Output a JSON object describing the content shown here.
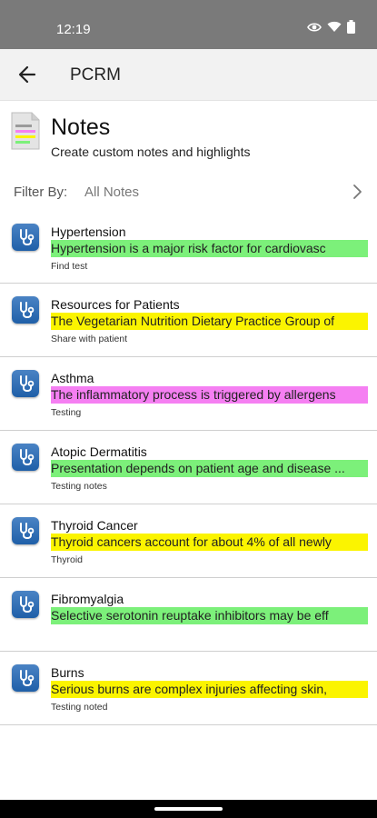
{
  "status_bar": {
    "time": "12:19",
    "icons": [
      "eye-icon",
      "wifi-icon",
      "battery-icon"
    ]
  },
  "app_bar": {
    "title": "PCRM",
    "back_icon": "back-arrow-icon"
  },
  "notes_header": {
    "title": "Notes",
    "subtitle": "Create custom notes and highlights"
  },
  "filter": {
    "label": "Filter By:",
    "value": "All Notes"
  },
  "colors": {
    "green_highlight": "#7cf07a",
    "yellow_highlight": "#fbf400",
    "pink_highlight": "#f57ff2",
    "icon_blue": "#1f5fa8"
  },
  "notes": [
    {
      "title": "Hypertension",
      "highlight": "Hypertension is a major risk factor for cardiovasc",
      "highlight_color": "#7cf07a",
      "meta": "Find test"
    },
    {
      "title": "Resources for Patients",
      "highlight": "The Vegetarian Nutrition Dietary Practice Group of",
      "highlight_color": "#fbf400",
      "meta": "Share with patient"
    },
    {
      "title": "Asthma",
      "highlight": "The inflammatory process is triggered by allergens",
      "highlight_color": "#f57ff2",
      "meta": "Testing"
    },
    {
      "title": "Atopic Dermatitis",
      "highlight": "Presentation depends on patient age and disease ...",
      "highlight_color": "#7cf07a",
      "meta": "Testing notes"
    },
    {
      "title": "Thyroid Cancer",
      "highlight": "Thyroid cancers account for about 4% of all newly",
      "highlight_color": "#fbf400",
      "meta": "Thyroid"
    },
    {
      "title": "Fibromyalgia",
      "highlight": "Selective serotonin reuptake inhibitors may be eff",
      "highlight_color": "#7cf07a",
      "meta": ""
    },
    {
      "title": "Burns",
      "highlight": "Serious burns are complex injuries affecting skin,",
      "highlight_color": "#fbf400",
      "meta": "Testing noted"
    }
  ]
}
